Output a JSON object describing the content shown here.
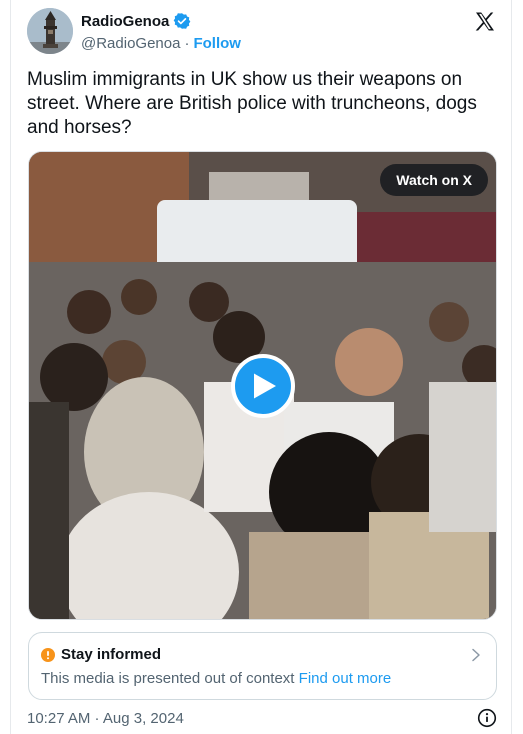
{
  "author": {
    "display_name": "RadioGenoa",
    "handle": "@RadioGenoa",
    "separator": "·",
    "follow_label": "Follow",
    "verified": true,
    "avatar_icon": "tower-avatar-icon"
  },
  "brand": {
    "logo_icon": "x-logo-icon"
  },
  "tweet": {
    "text": "Muslim immigrants in UK show us their weapons on street. Where are British police with truncheons, dogs and horses?"
  },
  "media": {
    "type": "video",
    "watch_label": "Watch on X",
    "play_icon": "play-icon"
  },
  "context_note": {
    "icon": "alert-icon",
    "title": "Stay informed",
    "body": "This media is presented out of context",
    "link": "Find out more",
    "chevron_icon": "chevron-right-icon"
  },
  "footer": {
    "timestamp": "10:27 AM · Aug 3, 2024",
    "info_icon": "info-icon"
  },
  "colors": {
    "accent": "#1d9bf0",
    "text_primary": "#0f1419",
    "text_secondary": "#536471",
    "border": "#cfd9de",
    "alert": "#f7931a"
  }
}
